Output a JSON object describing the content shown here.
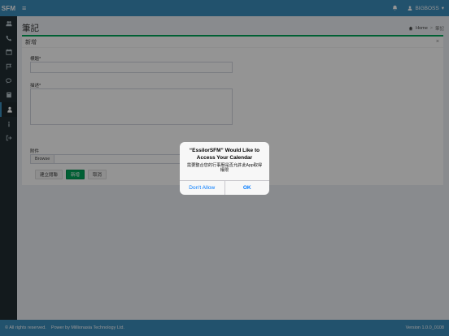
{
  "topbar": {
    "logo": "SFM",
    "hamburger": "≡",
    "user": "BIGBOSS"
  },
  "sidebar": {
    "items": [
      {
        "icon": "users-icon"
      },
      {
        "icon": "phone-icon"
      },
      {
        "icon": "calendar-icon"
      },
      {
        "icon": "flag-icon"
      },
      {
        "icon": "chat-icon"
      },
      {
        "icon": "book-icon"
      },
      {
        "icon": "user-lock-icon",
        "active": true
      },
      {
        "icon": "info-icon"
      },
      {
        "icon": "sign-out-icon"
      }
    ]
  },
  "page": {
    "title": "筆記",
    "breadcrumb_home": "Home",
    "breadcrumb_sep": ">",
    "breadcrumb_current": "筆記"
  },
  "form": {
    "header": "新增",
    "close": "×",
    "title_label": "標題*",
    "desc_label": "描述*",
    "attach_label": "附件",
    "browse": "Browse",
    "btn_create_list": "建立閱聯",
    "btn_add": "新增",
    "btn_cancel": "取消"
  },
  "footer": {
    "left": "© All rights reserved.    Power by Millionasia Technology Ltd.",
    "version": "Version 1.0.0_0108"
  },
  "alert": {
    "title": "“EssilorSFM” Would Like to Access Your Calendar",
    "message": "需要整合您的行事曆是否允許此App取得權限",
    "deny": "Don't Allow",
    "ok": "OK"
  },
  "colors": {
    "header": "#3c8dbc",
    "sidebar": "#222d32",
    "accent_green": "#00a65a",
    "ios_blue": "#007aff"
  }
}
